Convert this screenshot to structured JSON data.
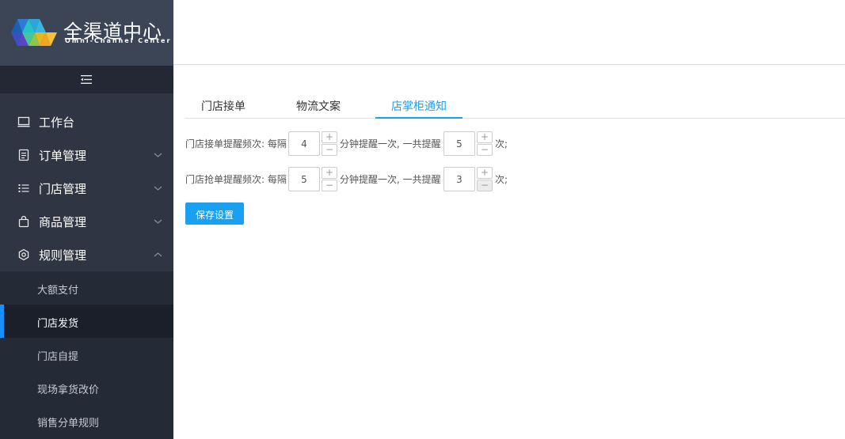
{
  "colors": {
    "sidebar_bg": "#2f3542",
    "accent": "#1aa0f0",
    "active_indicator": "#1890ff"
  },
  "brand": {
    "title_cn": "全渠道中心",
    "title_en": "Omni-Channel Center"
  },
  "sidebar": {
    "collapse_icon": "menu-collapse-icon",
    "menu": [
      {
        "label": "工作台",
        "icon": "monitor-icon",
        "expandable": false
      },
      {
        "label": "订单管理",
        "icon": "document-icon",
        "expandable": true,
        "expanded": false
      },
      {
        "label": "门店管理",
        "icon": "list-icon",
        "expandable": true,
        "expanded": false
      },
      {
        "label": "商品管理",
        "icon": "bag-icon",
        "expandable": true,
        "expanded": false
      },
      {
        "label": "规则管理",
        "icon": "rule-icon",
        "expandable": true,
        "expanded": true
      }
    ],
    "submenu": [
      {
        "label": "大额支付",
        "active": false
      },
      {
        "label": "门店发货",
        "active": true
      },
      {
        "label": "门店自提",
        "active": false
      },
      {
        "label": "现场拿货改价",
        "active": false
      },
      {
        "label": "销售分单规则",
        "active": false
      }
    ]
  },
  "tabs": [
    {
      "label": "门店接单",
      "active": false
    },
    {
      "label": "物流文案",
      "active": false
    },
    {
      "label": "店掌柜通知",
      "active": true
    }
  ],
  "settings": [
    {
      "label": "门店接单提醒频次: 每隔",
      "interval": "4",
      "middle": "分钟提醒一次, 一共提醒",
      "count": "5",
      "suffix": "次;",
      "count_decrement_disabled": false
    },
    {
      "label": "门店抢单提醒频次: 每隔",
      "interval": "5",
      "middle": "分钟提醒一次, 一共提醒",
      "count": "3",
      "suffix": "次;",
      "count_decrement_disabled": true
    }
  ],
  "stepper": {
    "plus": "+",
    "minus": "−"
  },
  "save_button": "保存设置"
}
